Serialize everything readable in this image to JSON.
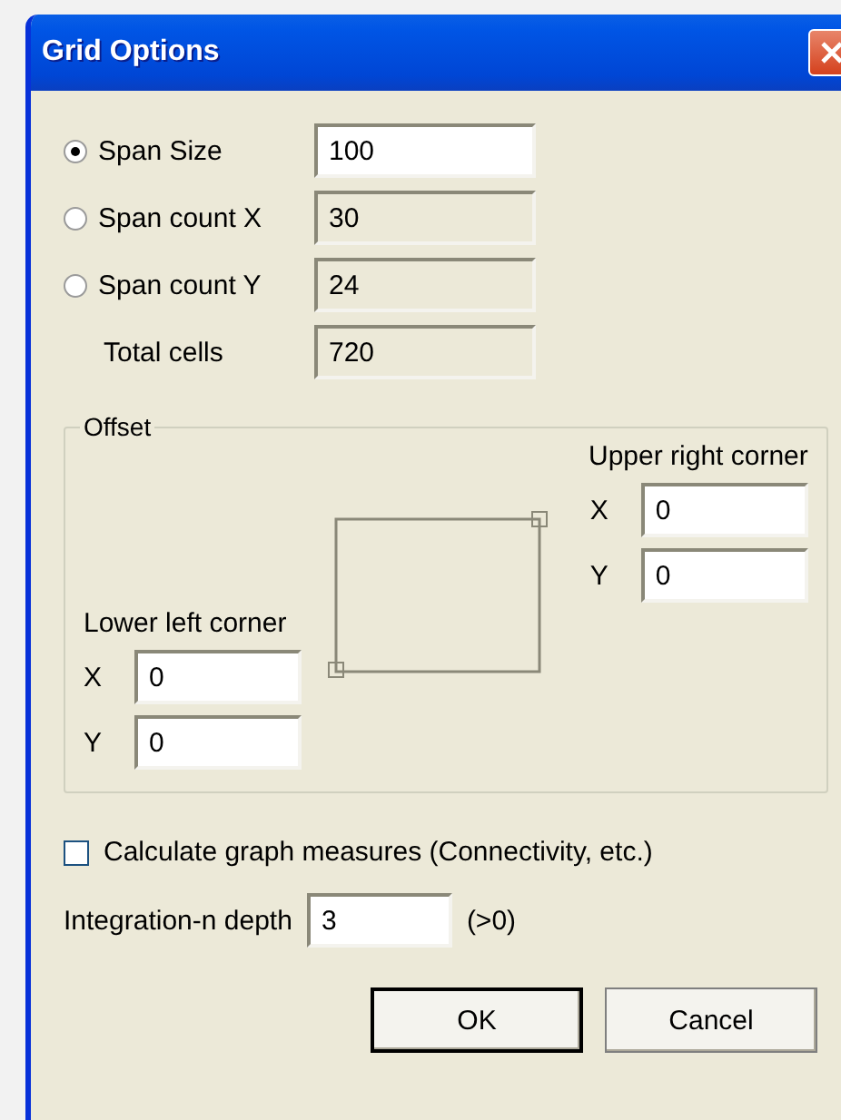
{
  "window": {
    "title": "Grid Options"
  },
  "span_options": [
    {
      "kind": "radio",
      "label": "Span Size",
      "selected": true,
      "value": "100",
      "disabled": false
    },
    {
      "kind": "radio",
      "label": "Span count X",
      "selected": false,
      "value": "30",
      "disabled": true
    },
    {
      "kind": "radio",
      "label": "Span count Y",
      "selected": false,
      "value": "24",
      "disabled": true
    },
    {
      "kind": "readout",
      "label": "Total cells",
      "value": "720",
      "disabled": true
    }
  ],
  "offset": {
    "title": "Offset",
    "upper_right": {
      "label": "Upper right corner",
      "fields": [
        {
          "label": "X",
          "value": "0"
        },
        {
          "label": "Y",
          "value": "0"
        }
      ]
    },
    "lower_left": {
      "label": "Lower left corner",
      "fields": [
        {
          "label": "X",
          "value": "0"
        },
        {
          "label": "Y",
          "value": "0"
        }
      ]
    }
  },
  "graph_measures": {
    "label": "Calculate graph measures (Connectivity, etc.)",
    "checked": false
  },
  "integration_depth": {
    "label": "Integration-n depth",
    "value": "3",
    "hint": "(>0)"
  },
  "buttons": [
    {
      "label": "OK",
      "default": true
    },
    {
      "label": "Cancel",
      "default": false
    }
  ]
}
